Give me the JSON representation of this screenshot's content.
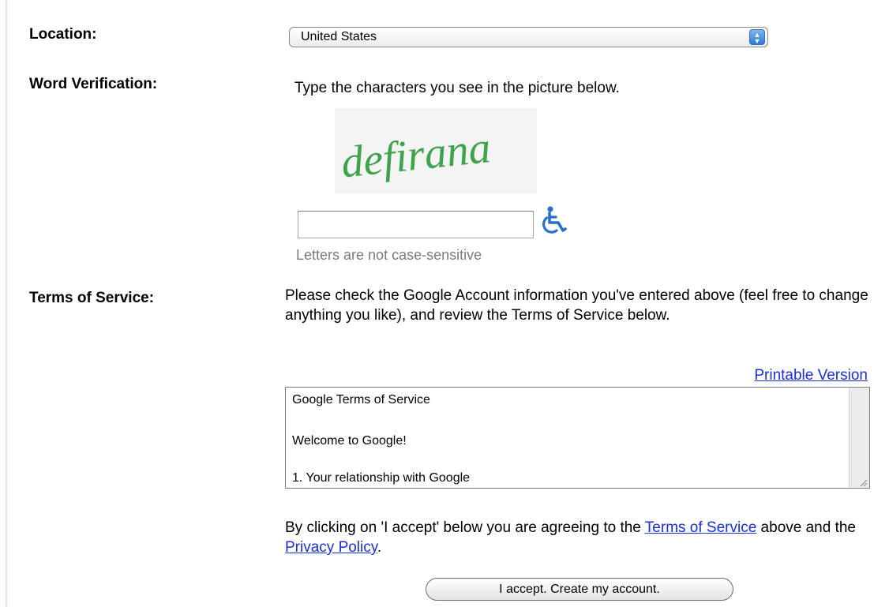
{
  "location": {
    "label": "Location:",
    "selected": "United States"
  },
  "word_verification": {
    "label": "Word Verification:",
    "instruction": "Type the characters you see in the picture below.",
    "captcha_text": "defirana",
    "input_value": "",
    "hint": "Letters are not case-sensitive"
  },
  "terms": {
    "label": "Terms of Service:",
    "intro": "Please check the Google Account information you've entered above (feel free to change anything you like), and review the Terms of Service below.",
    "printable_link": "Printable Version",
    "box_lines": [
      "Google Terms of Service",
      "Welcome to Google!",
      "1. Your relationship with Google"
    ],
    "agree_prefix": "By clicking on 'I accept' below you are agreeing to the ",
    "tos_link": "Terms of Service",
    "agree_middle": " above and the ",
    "privacy_link": "Privacy Policy",
    "agree_suffix": "."
  },
  "accept_button": "I accept. Create my account.",
  "colors": {
    "link": "#1a2fd6",
    "captcha": "#3fa34d",
    "accessibility_icon": "#2a6fc6",
    "hint": "#7b7b7b"
  },
  "icons": {
    "select_arrows": "up-down-arrows-icon",
    "accessibility": "wheelchair-icon",
    "resize": "resize-grip-icon"
  }
}
